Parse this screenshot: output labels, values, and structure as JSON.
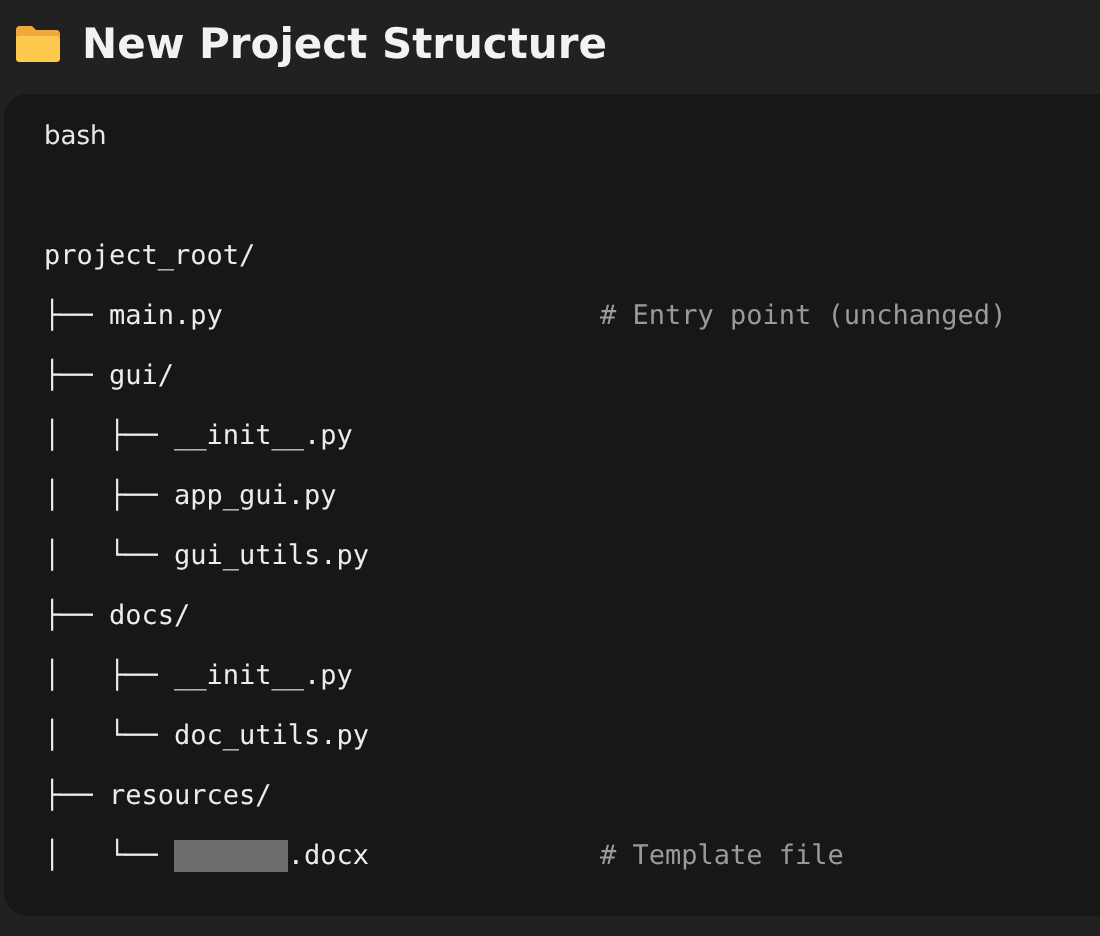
{
  "heading": {
    "title": "New Project Structure"
  },
  "code_block": {
    "language": "bash",
    "lines": [
      {
        "text": "project_root/"
      },
      {
        "text": "├── main.py",
        "comment": "# Entry point (unchanged)"
      },
      {
        "text": "├── gui/"
      },
      {
        "text": "│   ├── __init__.py"
      },
      {
        "text": "│   ├── app_gui.py"
      },
      {
        "text": "│   └── gui_utils.py"
      },
      {
        "text": "├── docs/"
      },
      {
        "text": "│   ├── __init__.py"
      },
      {
        "text": "│   └── doc_utils.py"
      },
      {
        "text": "├── resources/"
      },
      {
        "text": "│   └──",
        "redacted": true,
        "suffix": ".docx",
        "comment": "# Template file"
      }
    ]
  }
}
